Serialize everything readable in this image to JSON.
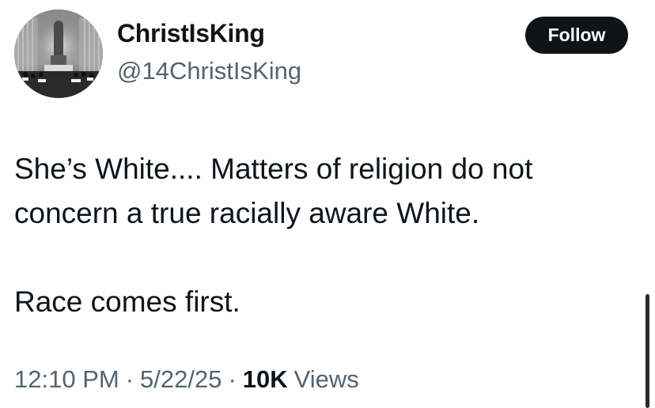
{
  "tweet": {
    "author": {
      "display_name": "ChristIsKing",
      "handle": "@14ChristIsKing",
      "avatar_icon": "monochrome-avatar-photo"
    },
    "follow_label": "Follow",
    "text_lines": [
      "She’s White.... Matters of religion do not",
      "concern a true racially aware White.",
      "",
      "Race comes first."
    ],
    "time": "12:10 PM",
    "separator": "·",
    "date": "5/22/25",
    "views_count": "10K",
    "views_label": "Views"
  },
  "colors": {
    "text_primary": "#0f1419",
    "text_secondary": "#536471",
    "button_bg": "#0f1419",
    "button_text": "#ffffff",
    "background": "#ffffff"
  }
}
